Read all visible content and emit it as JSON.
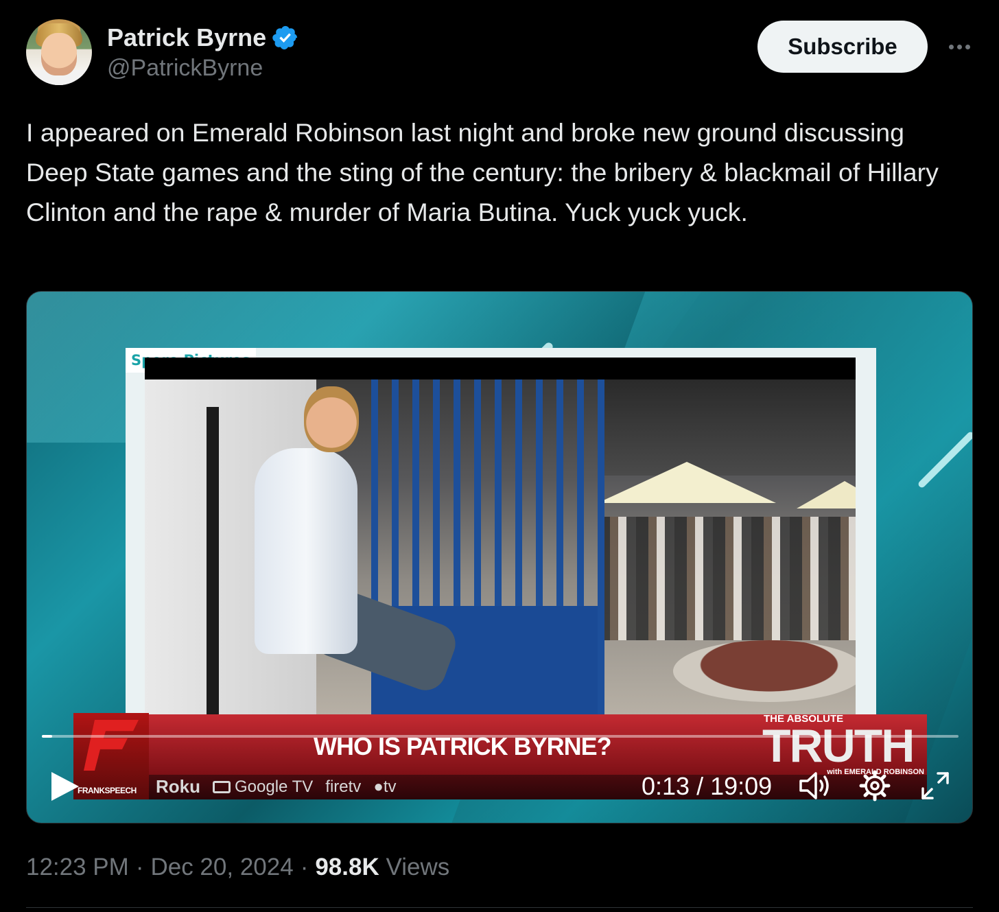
{
  "author": {
    "display_name": "Patrick Byrne",
    "handle": "@PatrickByrne",
    "verified": true
  },
  "actions": {
    "subscribe_label": "Subscribe"
  },
  "tweet": {
    "text": "I appeared on Emerald Robinson last night and broke new ground discussing Deep State games and the sting of the century: the bribery & blackmail of Hillary Clinton and the rape & murder of Maria Butina. Yuck yuck yuck."
  },
  "video": {
    "watermark": "Spero Pictures",
    "lower_third": {
      "title": "WHO IS PATRICK BYRNE?",
      "logo_text": "FRANKSPEECH",
      "networks": [
        "Roku",
        "Google TV",
        "firetv",
        "tv"
      ],
      "brand_small": "THE ABSOLUTE",
      "brand_big": "TRUTH",
      "brand_with": "with EMERALD ROBINSON"
    },
    "current_time": "0:13",
    "duration": "19:09",
    "time_display": "0:13 / 19:09",
    "progress_fraction": 0.011
  },
  "meta": {
    "time": "12:23 PM",
    "date": "Dec 20, 2024",
    "views_count": "98.8K",
    "views_label": "Views",
    "separator": "·"
  },
  "colors": {
    "background": "#000000",
    "text_primary": "#e7e9ea",
    "text_secondary": "#71767b",
    "verified_blue": "#1d9bf0",
    "subscribe_bg": "#eff3f4"
  }
}
